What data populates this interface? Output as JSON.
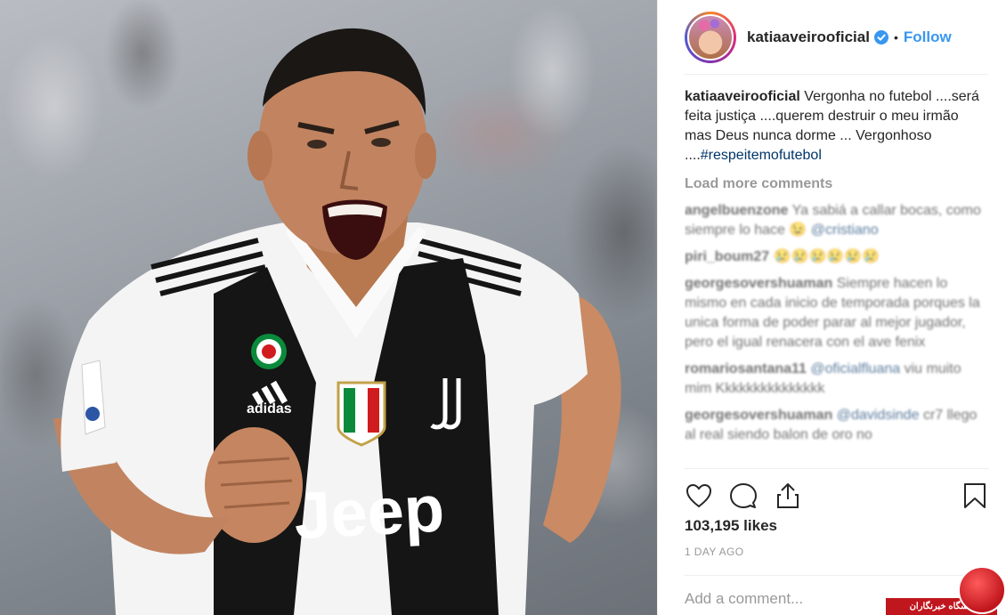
{
  "post": {
    "username": "katiaaveirooficial",
    "follow_label": "Follow",
    "separator": "•",
    "caption": {
      "user": "katiaaveirooficial",
      "text": "Vergonha no futebol ....será feita justiça ....querem destruir o meu irmão mas Deus nunca dorme ... Vergonhoso ....",
      "hashtag": "#respeitemofutebol"
    },
    "load_more_label": "Load more comments",
    "comments": [
      {
        "user": "angelbuenzone",
        "mention": "@cristiano",
        "text": "Ya sabiá a callar bocas, como siempre lo hace 😉"
      },
      {
        "user": "piri_boum27",
        "mention": "",
        "text": "😢😢😢😢😢😢"
      },
      {
        "user": "georgesovershuaman",
        "mention": "",
        "text": "Siempre hacen lo mismo en cada inicio de temporada porques la unica forma de poder parar al mejor jugador, pero el igual renacera con el ave fenix"
      },
      {
        "user": "romariosantana11",
        "mention": "@oficialfluana",
        "text": "viu muito mim Kkkkkkkkkkkkkkk"
      },
      {
        "user": "georgesovershuaman",
        "mention": "@davidsinde",
        "text": "cr7 llego al real siendo balon de oro no"
      }
    ],
    "likes": "103,195 likes",
    "time_ago": "1 DAY AGO",
    "add_comment_placeholder": "Add a comment..."
  },
  "photo": {
    "jersey_sponsor": "Jeep",
    "jersey_brand": "adidas"
  },
  "watermark": {
    "text": "باشگاه خبرنگاران"
  },
  "colors": {
    "link_blue": "#3897f0",
    "hashtag_blue": "#003569",
    "muted": "#999999",
    "watermark_red": "#c0161d"
  }
}
